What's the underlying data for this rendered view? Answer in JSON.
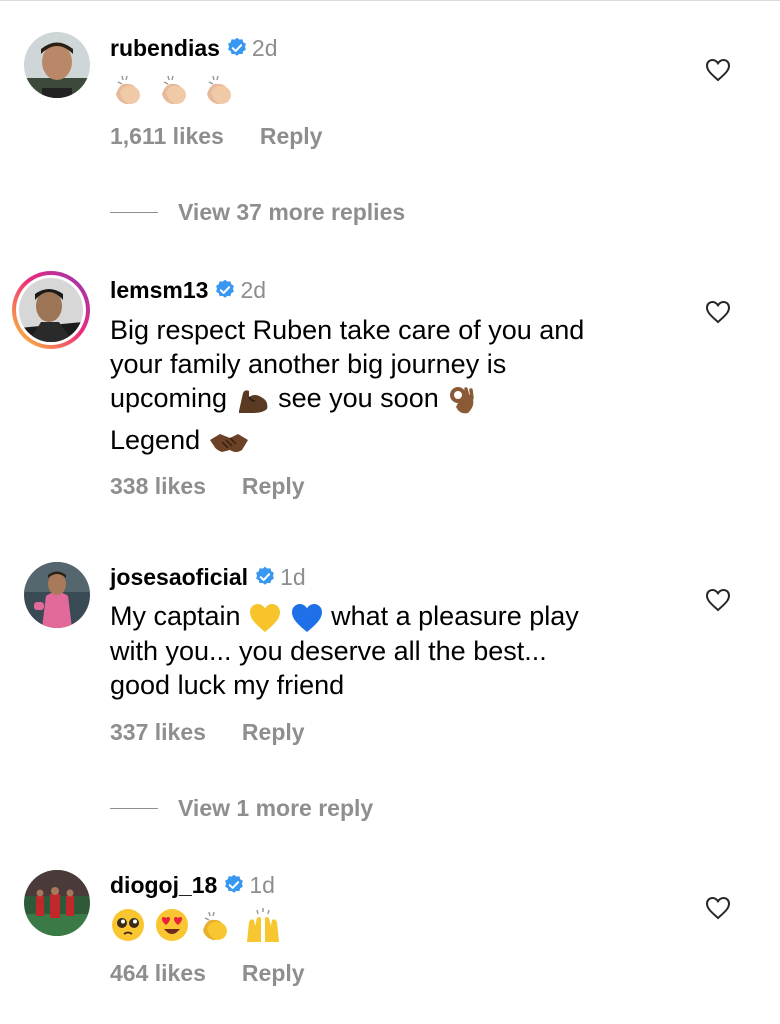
{
  "comments": [
    {
      "username": "rubendias",
      "time": "2d",
      "text_lines": [],
      "emojis": [
        "clapping-hands",
        "clapping-hands",
        "clapping-hands"
      ],
      "likes": "1,611 likes",
      "reply": "Reply",
      "view_more": "View 37 more replies"
    },
    {
      "username": "lemsm13",
      "time": "2d",
      "text_lines": [
        "Big respect Ruben take care of you and",
        "your family another big journey is",
        "upcoming",
        "see you soon",
        "Legend"
      ],
      "likes": "338 likes",
      "reply": "Reply"
    },
    {
      "username": "josesaoficial",
      "time": "1d",
      "text_lines": [
        "My captain",
        "what a pleasure play",
        "with you... you deserve all the best...",
        "good luck my friend"
      ],
      "likes": "337 likes",
      "reply": "Reply",
      "view_more": "View 1 more reply"
    },
    {
      "username": "diogoj_18",
      "time": "1d",
      "text_lines": [],
      "emojis": [
        "pleading-face",
        "heart-eyes-face",
        "clapping-hands",
        "raising-hands"
      ],
      "likes": "464 likes",
      "reply": "Reply"
    }
  ],
  "colors": {
    "text": "#000000",
    "secondary": "#8e8e8e",
    "verified": "#3897f0",
    "divider": "#dbdbdb"
  }
}
